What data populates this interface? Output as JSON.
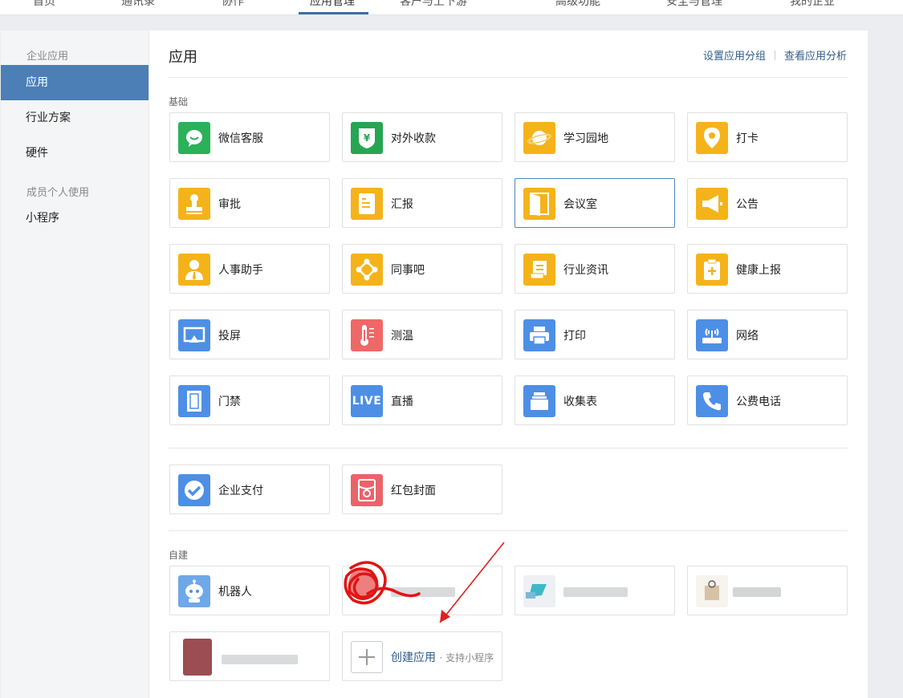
{
  "top_nav": {
    "items": [
      "首页",
      "通讯录",
      "协作",
      "应用管理",
      "客户与上下游",
      "高级功能",
      "安全与管理",
      "我的企业"
    ],
    "active_index": 3
  },
  "sidebar": {
    "section1": "企业应用",
    "items1": [
      "应用",
      "行业方案",
      "硬件"
    ],
    "active": "应用",
    "section2": "成员个人使用",
    "items2": [
      "小程序"
    ]
  },
  "main": {
    "title": "应用",
    "links": [
      "设置应用分组",
      "查看应用分析"
    ],
    "basic_label": "基础",
    "basic_apps": [
      {
        "name": "微信客服",
        "icon": "chat-bubble-icon",
        "color": "#2ab159"
      },
      {
        "name": "对外收款",
        "icon": "yuan-shield-icon",
        "color": "#26a653"
      },
      {
        "name": "学习园地",
        "icon": "planet-icon",
        "color": "#f5b31a"
      },
      {
        "name": "打卡",
        "icon": "location-pin-icon",
        "color": "#f5b31a"
      },
      {
        "name": "审批",
        "icon": "stamp-icon",
        "color": "#f5b31a"
      },
      {
        "name": "汇报",
        "icon": "report-sheet-icon",
        "color": "#f5b31a"
      },
      {
        "name": "会议室",
        "icon": "door-icon",
        "color": "#f5b31a"
      },
      {
        "name": "公告",
        "icon": "megaphone-icon",
        "color": "#f5b31a"
      },
      {
        "name": "人事助手",
        "icon": "person-tie-icon",
        "color": "#f5b31a"
      },
      {
        "name": "同事吧",
        "icon": "nodes-icon",
        "color": "#f5b31a"
      },
      {
        "name": "行业资讯",
        "icon": "scroll-icon",
        "color": "#f5b31a"
      },
      {
        "name": "健康上报",
        "icon": "medical-clipboard-icon",
        "color": "#f5b31a"
      },
      {
        "name": "投屏",
        "icon": "screen-cast-icon",
        "color": "#4d8fe6"
      },
      {
        "name": "测温",
        "icon": "thermometer-icon",
        "color": "#f06767"
      },
      {
        "name": "打印",
        "icon": "printer-icon",
        "color": "#4d8fe6"
      },
      {
        "name": "网络",
        "icon": "router-icon",
        "color": "#4d8fe6"
      },
      {
        "name": "门禁",
        "icon": "access-door-icon",
        "color": "#4d8fe6"
      },
      {
        "name": "直播",
        "icon": "live-icon",
        "icon_text": "LIVE",
        "color": "#4d8fe6"
      },
      {
        "name": "收集表",
        "icon": "form-stack-icon",
        "color": "#4d8fe6"
      },
      {
        "name": "公费电话",
        "icon": "phone-icon",
        "color": "#4d8fe6"
      }
    ],
    "highlighted_app": "会议室",
    "pay_apps": [
      {
        "name": "企业支付",
        "icon": "pay-check-icon",
        "color": "#4d8fe6"
      },
      {
        "name": "红包封面",
        "icon": "red-packet-icon",
        "color": "#e8646a"
      }
    ],
    "custom_label": "自建",
    "custom_apps": [
      {
        "name": "机器人",
        "icon": "robot-icon"
      }
    ],
    "create": {
      "label": "创建应用",
      "sub": "· 支持小程序"
    }
  },
  "annotation": {
    "arrow_color": "#e02020",
    "scribble_color": "#e01515"
  }
}
